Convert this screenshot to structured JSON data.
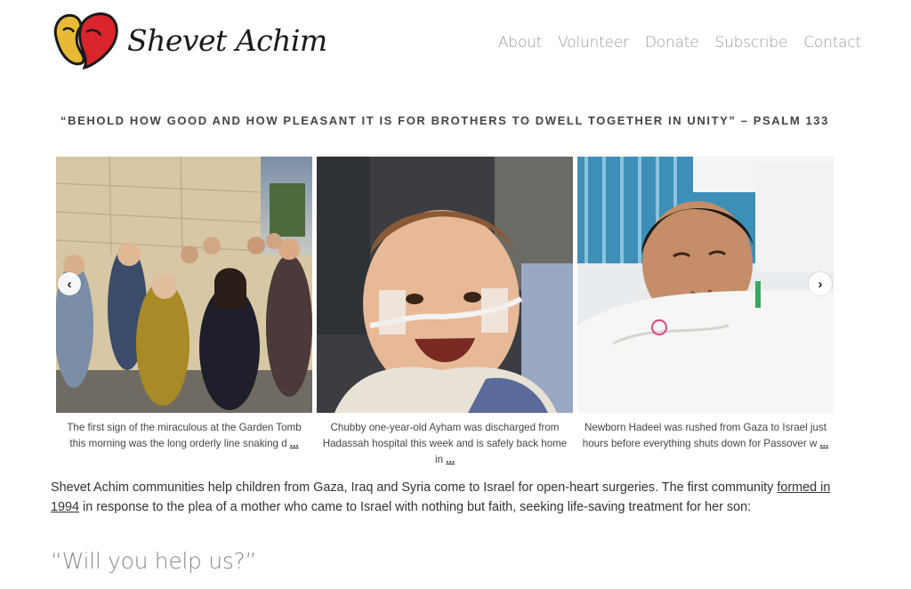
{
  "header": {
    "logo_text": "Shevet Achim",
    "nav": [
      "About",
      "Volunteer",
      "Donate",
      "Subscribe",
      "Contact"
    ]
  },
  "motto": "“BEHOLD HOW GOOD AND HOW PLEASANT IT IS FOR BROTHERS TO DWELL TOGETHER IN UNITY” – PSALM 133",
  "carousel": {
    "prev_label": "‹",
    "next_label": "›",
    "slides": [
      {
        "caption": "The first sign of the miraculous at the Garden Tomb this morning was the long orderly line snaking d",
        "more": "...",
        "photo_icon": "group-photo"
      },
      {
        "caption": "Chubby one-year-old Ayham was discharged from Hadassah hospital this week and is safely back home in",
        "more": "...",
        "photo_icon": "baby-photo"
      },
      {
        "caption": "Newborn Hadeel was rushed from Gaza to Israel just hours before everything shuts down for Passover w",
        "more": "...",
        "photo_icon": "newborn-photo"
      }
    ]
  },
  "intro": {
    "part1": "Shevet Achim communities help children from Gaza, Iraq and Syria come to Israel for open-heart surgeries. The first community ",
    "link": "formed in 1994",
    "part2": " in response to the plea of a mother who came to Israel with nothing but faith, seeking life-saving treatment for her son:"
  },
  "quote": "“Will you help us?”",
  "colors": {
    "logo_red": "#d9252b",
    "logo_yellow": "#e8b935",
    "nav_gray": "#9a9a9a"
  }
}
